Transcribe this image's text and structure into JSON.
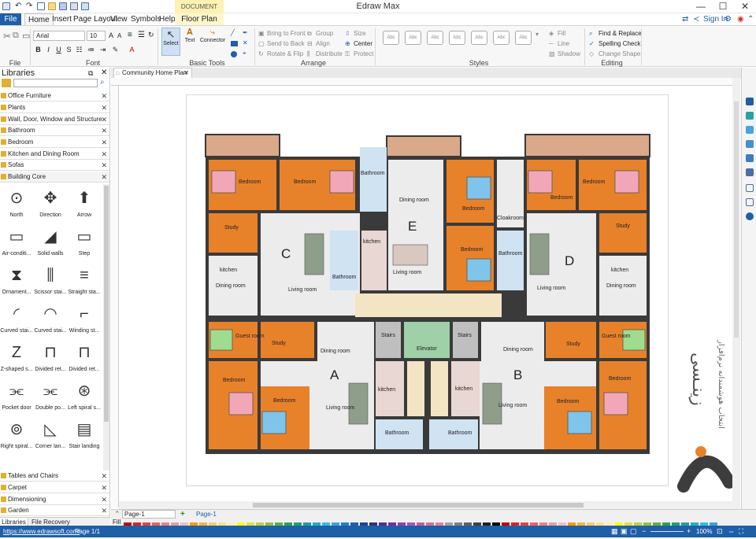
{
  "window": {
    "title": "Edraw Max"
  },
  "quick_access": [
    "new-icon",
    "undo-icon",
    "redo-icon",
    "open-icon",
    "save-icon",
    "print-icon",
    "export-icon"
  ],
  "ribbon_tabs": [
    {
      "label": "File"
    },
    {
      "label": "Home"
    },
    {
      "label": "Insert"
    },
    {
      "label": "Page Layout"
    },
    {
      "label": "View"
    },
    {
      "label": "Symbols"
    },
    {
      "label": "Help"
    }
  ],
  "context_tab": {
    "header": "DOCUMENT TOO...",
    "label": "Floor Plan"
  },
  "top_right": {
    "signin": "Sign In"
  },
  "ribbon": {
    "file_group": "File",
    "font_group": "Font",
    "font_name": "Arial",
    "font_size": "10",
    "basic_tools_group": "Basic Tools",
    "select": "Select",
    "text": "Text",
    "connector": "Connector",
    "arrange_group": "Arrange",
    "bring_to_front": "Bring to Front",
    "send_to_back": "Send to Back",
    "rotate_flip": "Rotate & Flip",
    "group": "Group",
    "align": "Align",
    "distribute": "Distribute",
    "size": "Size",
    "center": "Center",
    "protect": "Protect",
    "styles_group": "Styles",
    "style_sample": "Abc",
    "fill": "Fill",
    "line": "Line",
    "shadow": "Shadow",
    "editing_group": "Editing",
    "find_replace": "Find & Replace",
    "spelling": "Spelling Check",
    "change_shape": "Change Shape"
  },
  "libraries": {
    "title": "Libraries",
    "categories_top": [
      "Office Furniture",
      "Plants",
      "Wall, Door, Window and Structure",
      "Bathroom",
      "Bedroom",
      "Kitchen and Dining Room",
      "Sofas",
      "Building Core"
    ],
    "shapes": [
      "North",
      "Direction",
      "Arrow",
      "Air-conditi...",
      "Solid walls",
      "Step",
      "Ornament...",
      "Scissor stai...",
      "Straight sta...",
      "Curved stai...",
      "Curved stai...",
      "Winding st...",
      "Z-shaped s...",
      "Divided ret...",
      "Divided ret...",
      "Pocket door",
      "Double po...",
      "Left spiral s...",
      "Right spiral...",
      "Corner lan...",
      "Stair landing"
    ],
    "categories_bottom": [
      "Tables and Chairs",
      "Carpet",
      "Dimensioning",
      "Garden"
    ],
    "bottom_tabs": [
      "Libraries",
      "File Recovery"
    ]
  },
  "document_tab": "Community Home Plan",
  "page_tabs": {
    "current": "Page-1",
    "tab": "Page-1",
    "fill_label": "Fill"
  },
  "floor_plan": {
    "units": [
      "A",
      "B",
      "C",
      "D",
      "E"
    ],
    "rooms": {
      "bedroom": "Bedroom",
      "study": "Study",
      "kitchen": "kitchen",
      "dining": "Dining room",
      "living": "Living room",
      "bathroom": "Bathroom",
      "guest": "Guest room",
      "stairs": "Stairs",
      "elevator": "Elevator",
      "cloakroom": "Cloakroom"
    }
  },
  "watermark_text": "زینـسی",
  "watermark_sub": "انتخاب هوشمندانه نرم‌افزار",
  "status": {
    "url": "https://www.edrawsoft.com/",
    "page": "Page 1/1",
    "zoom": "100%"
  },
  "colors": {
    "accent": "#1e5fa8",
    "wood": "#e8822a",
    "floor": "#ececec",
    "wall": "#3a3a3a",
    "roof": "#d9a98a"
  }
}
